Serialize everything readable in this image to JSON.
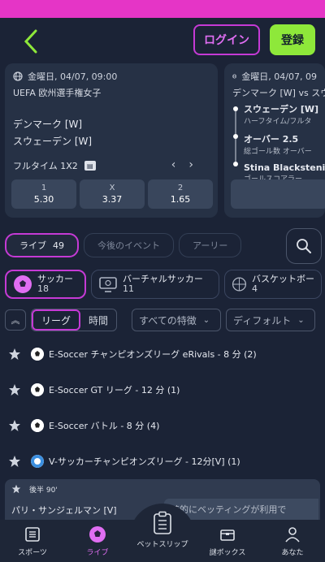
{
  "header": {
    "login": "ログイン",
    "register": "登録"
  },
  "featured": [
    {
      "datetime": "金曜日, 04/07, 09:00",
      "competition": "UEFA 欧州選手権女子",
      "home": "デンマーク [W]",
      "away": "スウェーデン [W]",
      "market": "フルタイム 1X2",
      "odds": [
        {
          "label": "1",
          "value": "5.30"
        },
        {
          "label": "X",
          "value": "3.37"
        },
        {
          "label": "2",
          "value": "1.65"
        }
      ]
    },
    {
      "datetime": "金曜日, 04/07, 09",
      "title": "デンマーク [W] vs スウ",
      "lines": [
        {
          "main": "スウェーデン [W]",
          "sub": "ハーフタイム/フルタ"
        },
        {
          "main": "オーバー 2.5",
          "sub": "総ゴール数 オーバー"
        },
        {
          "main": "Stina Blackstenius",
          "sub": "ゴールスコアラー"
        }
      ]
    }
  ],
  "filters": [
    {
      "label": "ライブ",
      "count": "49"
    },
    {
      "label": "今後のイベント"
    },
    {
      "label": "アーリー"
    }
  ],
  "sports": [
    {
      "name": "サッカー",
      "count": "18"
    },
    {
      "name": "バーチャルサッカー",
      "count": "11"
    },
    {
      "name": "バスケットボー",
      "count": "4"
    }
  ],
  "view": {
    "league": "リーグ",
    "time": "時間",
    "features": "すべての特徴",
    "sort": "ディフォルト"
  },
  "leagues": [
    "E-Soccer チャンピオンズリーグ eRivals - 8 分 (2)",
    "E-Soccer GT リーグ - 12 分 (1)",
    "E-Soccer バトル - 8 分 (4)",
    "V-サッカーチャンピオンズリーグ - 12分[V] (1)"
  ],
  "live_match": {
    "period": "後半 90'",
    "team": "パリ・サンジェルマン [V]",
    "note": "時的にベッティングが利用で"
  },
  "nav": [
    {
      "label": "スポーツ"
    },
    {
      "label": "ライブ"
    },
    {
      "label": "ベットスリップ"
    },
    {
      "label": "謎ボックス"
    },
    {
      "label": "あなた"
    }
  ],
  "colors": {
    "accent": "#c53ad5",
    "register": "#8ee83a",
    "bg": "#1b2336"
  }
}
